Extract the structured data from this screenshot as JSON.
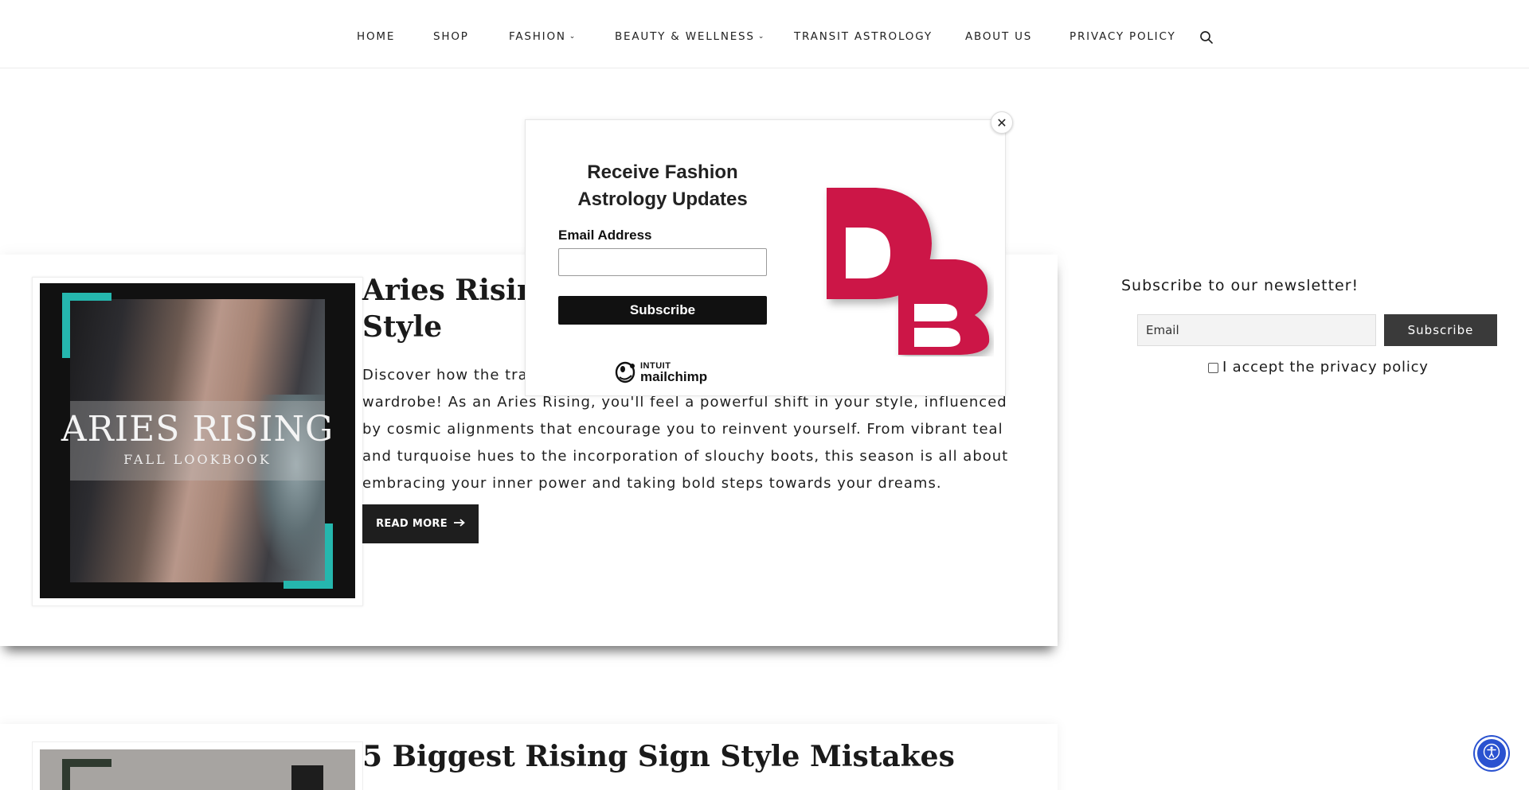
{
  "nav": {
    "items": [
      {
        "label": "HOME"
      },
      {
        "label": "SHOP"
      },
      {
        "label": "FASHION"
      },
      {
        "label": "BEAUTY & WELLNESS"
      },
      {
        "label": "TRANSIT ASTROLOGY"
      },
      {
        "label": "ABOUT US"
      },
      {
        "label": "PRIVACY POLICY"
      }
    ],
    "search_icon": "search-icon"
  },
  "posts": [
    {
      "title": "Aries Rising, Transform Your Personal Style",
      "thumbnail_title": "ARIES RISING",
      "thumbnail_subtitle": "FALL LOOKBOOK",
      "excerpt": "Discover how the transformative energy of this season will revolutionize your wardrobe! As an Aries Rising, you'll feel a powerful shift in your style, influenced by cosmic alignments that encourage you to reinvent yourself. From vibrant teal and turquoise hues to the incorporation of slouchy boots, this season is all about embracing your inner power and taking bold steps towards your dreams.",
      "read_more": "READ MORE",
      "read_more_icon": "arrow-right-icon"
    },
    {
      "title": "5 Biggest Rising Sign Style Mistakes"
    }
  ],
  "sidebar": {
    "newsletter_heading": "Subscribe to our newsletter!",
    "email_placeholder": "Email",
    "subscribe_label": "Subscribe",
    "privacy_label": "I accept the privacy policy"
  },
  "popup": {
    "title": "Receive Fashion Astrology Updates",
    "email_label": "Email Address",
    "email_value": "",
    "subscribe_label": "Subscribe",
    "close_icon": "close-icon",
    "mailchimp_intuit": "INTUIT",
    "mailchimp_name": "mailchimp",
    "brand_logo_text": "DB",
    "brand_color": "#cc1746"
  },
  "colors": {
    "accent_teal": "#25b7ae",
    "button_dark": "#1e1e1e",
    "a11y_blue": "#2a52d0"
  }
}
